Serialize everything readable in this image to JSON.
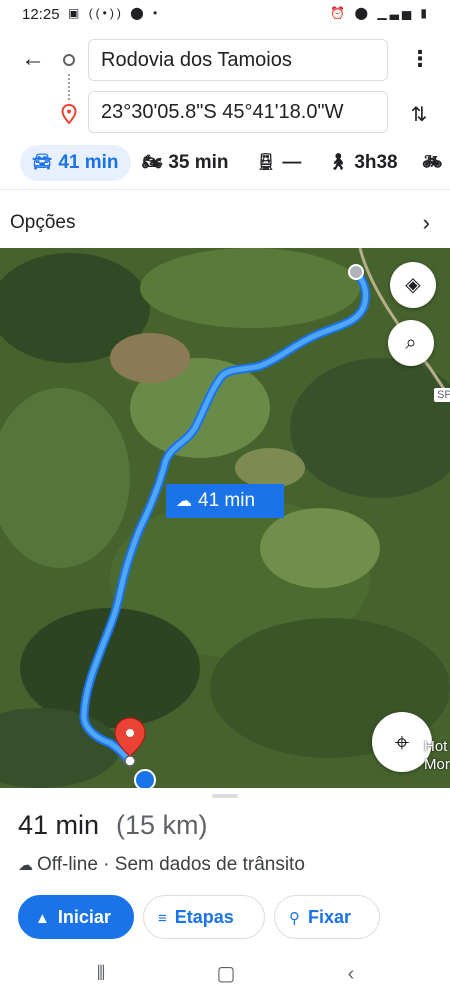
{
  "status_bar": {
    "time": "12:25",
    "left_icons": [
      "image-icon",
      "radio-icon",
      "location-icon",
      "dot-icon"
    ],
    "right_icons": [
      "alarm-icon",
      "location-icon",
      "signal-icon",
      "signal-icon",
      "battery-icon"
    ]
  },
  "search": {
    "origin_value": "Rodovia dos Tamoios",
    "destination_value": "23°30'05.8\"S 45°41'18.0\"W"
  },
  "modes": [
    {
      "name": "car",
      "label": "41 min",
      "icon": "car-icon",
      "active": true
    },
    {
      "name": "motorcycle",
      "label": "35 min",
      "icon": "motorcycle-icon",
      "active": false
    },
    {
      "name": "transit",
      "label": "—",
      "icon": "transit-icon",
      "active": false
    },
    {
      "name": "walk",
      "label": "3h38",
      "icon": "walk-icon",
      "active": false
    },
    {
      "name": "bike",
      "label": "",
      "icon": "bike-icon",
      "active": false
    }
  ],
  "options": {
    "label": "Opções"
  },
  "map": {
    "route_time_chip": "41 min",
    "road_label": "SP",
    "side_label": "Hot\nMor",
    "route_color": "#4fa6f5"
  },
  "sheet": {
    "duration": "41 min",
    "distance": "(15 km)",
    "status": "Off-line · Sem dados de trânsito",
    "buttons": {
      "start": "Iniciar",
      "steps": "Etapas",
      "pin": "Fixar"
    }
  },
  "colors": {
    "accent": "#1a73e8",
    "active_chip_bg": "#e8f0fe",
    "pin_red": "#ea4335"
  }
}
